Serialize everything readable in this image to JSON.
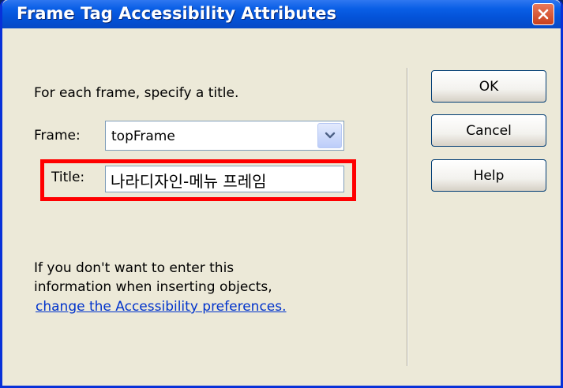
{
  "window": {
    "title": "Frame Tag Accessibility Attributes"
  },
  "form": {
    "instruction": "For each frame, specify a title.",
    "frame_label": "Frame:",
    "frame_value": "topFrame",
    "title_label": "Title:",
    "title_value": "나라디자인-메뉴 프레임"
  },
  "info": {
    "line1": "If you don't want to enter this",
    "line2": "information when inserting objects,",
    "link": "change the Accessibility preferences."
  },
  "buttons": {
    "ok": "OK",
    "cancel": "Cancel",
    "help": "Help"
  },
  "colors": {
    "highlight": "#FF0000",
    "link": "#0033CC",
    "titlebar": "#0453D9"
  }
}
